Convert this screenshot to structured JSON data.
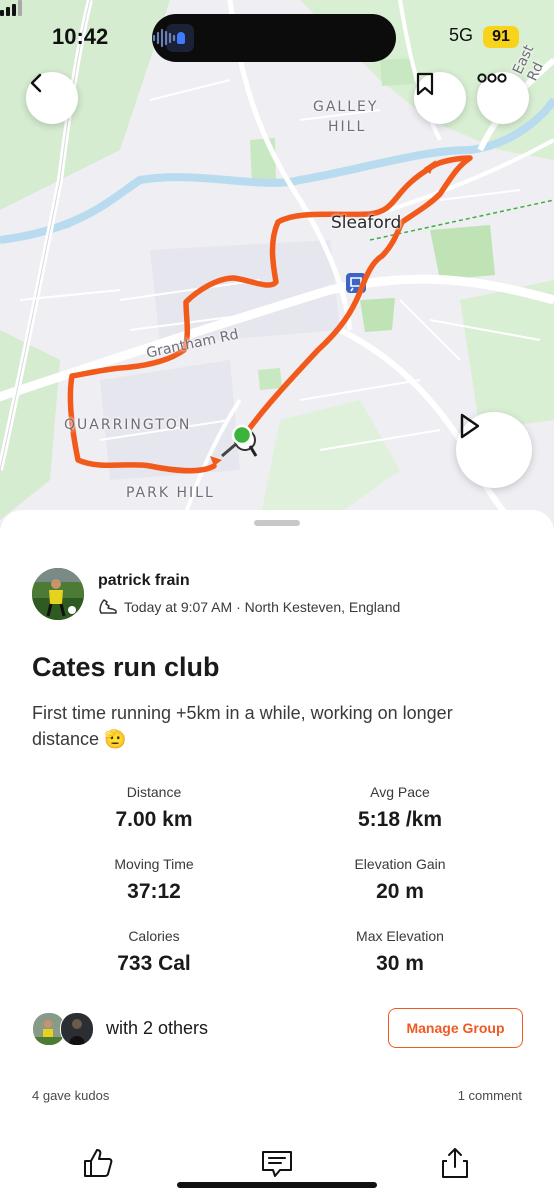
{
  "status_bar": {
    "time": "10:42",
    "network": "5G",
    "battery": "91"
  },
  "map": {
    "labels": {
      "galley": "GALLEY",
      "hill": "HILL",
      "sleaford": "Sleaford",
      "grantham_rd": "Grantham Rd",
      "quarrington": "QUARRINGTON",
      "park_hill": "PARK HILL",
      "east_rd": "East Rd"
    },
    "route_color": "#f25a1c",
    "start_marker_color": "#3cb43c"
  },
  "activity": {
    "athlete_name": "patrick frain",
    "meta": "Today at 9:07 AM · North Kesteven, England",
    "title": "Cates run club",
    "description": "First time running +5km in a while, working on longer distance 🫡",
    "stats": [
      {
        "label": "Distance",
        "value": "7.00 km"
      },
      {
        "label": "Avg Pace",
        "value": "5:18 /km"
      },
      {
        "label": "Moving Time",
        "value": "37:12"
      },
      {
        "label": "Elevation Gain",
        "value": "20 m"
      },
      {
        "label": "Calories",
        "value": "733 Cal"
      },
      {
        "label": "Max Elevation",
        "value": "30 m"
      }
    ],
    "group_text": "with 2 others",
    "manage_group_label": "Manage Group",
    "kudos_text": "4 gave kudos",
    "comments_text": "1 comment"
  },
  "colors": {
    "accent": "#f05a22"
  }
}
